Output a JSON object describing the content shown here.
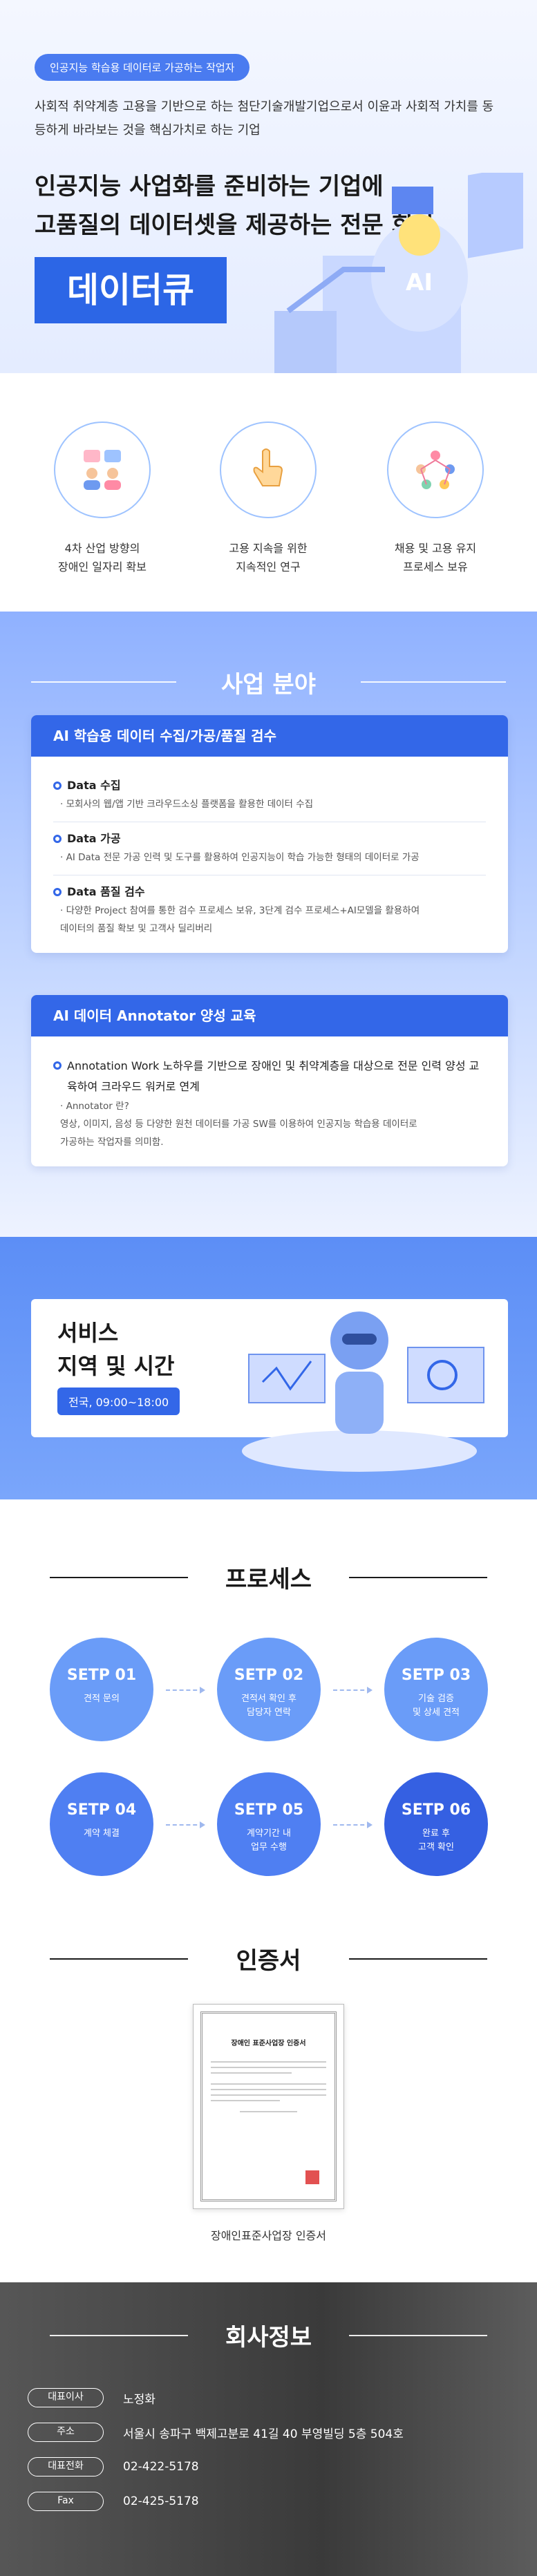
{
  "hero": {
    "pill": "인공지능 학습용 데이터로 가공하는 작업자",
    "intro": "사회적 취약계층 고용을 기반으로 하는 첨단기술개발기업으로서 이윤과 사회적 가치를 동등하게 바라보는 것을 핵심가치로 하는 기업",
    "headline_line1": "인공지능 사업화를 준비하는 기업에",
    "headline_line2": "고품질의 데이터셋을 제공하는 전문 회사",
    "brand": "데이터큐",
    "art_label": "AI"
  },
  "values": [
    {
      "line1": "4차 산업 방향의",
      "line2": "장애인 일자리 확보",
      "icon": "people-chat-icon"
    },
    {
      "line1": "고용 지속을 위한",
      "line2": "지속적인 연구",
      "icon": "hand-pointer-icon"
    },
    {
      "line1": "채용 및 고용 유지",
      "line2": "프로세스 보유",
      "icon": "people-network-icon"
    }
  ],
  "business": {
    "title": "사업 분야",
    "card1": {
      "header": "AI 학습용 데이터 수집/가공/품질 검수",
      "items": [
        {
          "title": "Data 수집",
          "desc": [
            "· 모회사의 웹/앱 기반 크라우드소싱 플랫폼을 활용한 데이터 수집"
          ]
        },
        {
          "title": "Data 가공",
          "desc": [
            "· AI Data 전문 가공 인력 및 도구를 활용하여 인공지능이 학습 가능한 형태의 데이터로 가공"
          ]
        },
        {
          "title": "Data 품질 검수",
          "desc": [
            "· 다양한 Project 참여를 통한 검수 프로세스 보유, 3단계 검수 프로세스+AI모델을 활용하여",
            "데이터의 품질 확보 및 고객사 딜리버리"
          ]
        }
      ]
    },
    "card2": {
      "header": "AI 데이터 Annotator 양성 교육",
      "items": [
        {
          "title": "Annotation Work 노하우를 기반으로 장애인 및 취약계층을 대상으로 전문 인력 양성 교육하여 크라우드 워커로 연계",
          "desc": [
            "· Annotator 란?",
            "영상, 이미지, 음성 등 다양한 원천 데이터를 가공 SW를 이용하여 인공지능 학습용 데이터로",
            "가공하는 작업자를 의미함."
          ]
        }
      ]
    }
  },
  "service": {
    "title_line1": "서비스",
    "title_line2": "지역 및 시간",
    "time": "전국, 09:00~18:00"
  },
  "process": {
    "title": "프로세스",
    "steps": [
      {
        "num": "SETP 01",
        "desc1": "견적 문의",
        "desc2": "",
        "color": "#6a9cf8"
      },
      {
        "num": "SETP 02",
        "desc1": "견적서 확인 후",
        "desc2": "담당자 연락",
        "color": "#6a9cf8"
      },
      {
        "num": "SETP 03",
        "desc1": "기술 검증",
        "desc2": "및 상세 견적",
        "color": "#6a9cf8"
      },
      {
        "num": "SETP 04",
        "desc1": "계약 체결",
        "desc2": "",
        "color": "#4f7ff2"
      },
      {
        "num": "SETP 05",
        "desc1": "계약기간 내",
        "desc2": "업무 수행",
        "color": "#4f7ff2"
      },
      {
        "num": "SETP 06",
        "desc1": "완료 후",
        "desc2": "고객 확인",
        "color": "#3560e2"
      }
    ]
  },
  "cert": {
    "title": "인증서",
    "doc_title": "장애인 표준사업장 인증서",
    "caption": "장애인표준사업장 인증서"
  },
  "company": {
    "title": "회사정보",
    "rows": [
      {
        "label": "대표이사",
        "value": "노정화"
      },
      {
        "label": "주소",
        "value": "서울시 송파구 백제고분로 41길 40 부영빌딩 5층 504호"
      },
      {
        "label": "대표전화",
        "value": "02-422-5178"
      },
      {
        "label": "Fax",
        "value": "02-425-5178"
      }
    ]
  }
}
